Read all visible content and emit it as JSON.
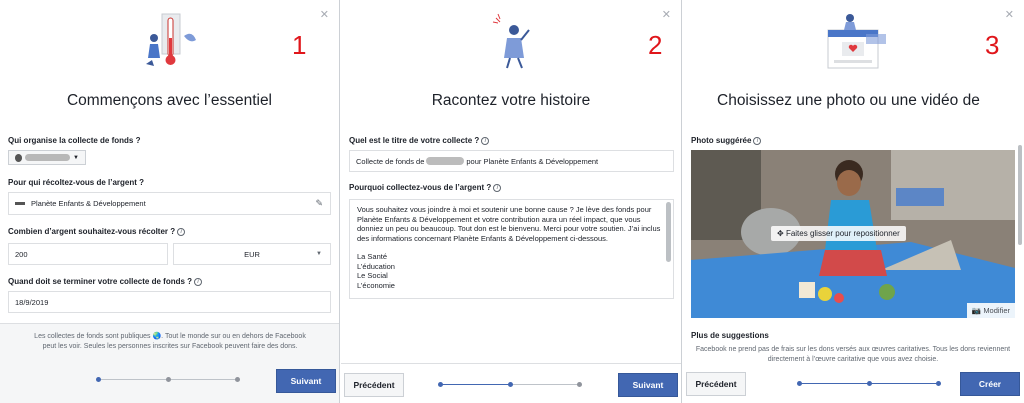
{
  "panel1": {
    "step": "1",
    "title": "Commençons avec l’essentiel",
    "organizer_label": "Qui organise la collecte de fonds ?",
    "beneficiary_label": "Pour qui récoltez-vous de l’argent ?",
    "beneficiary_value": "Planète Enfants & Développement",
    "amount_label": "Combien d’argent souhaitez-vous récolter ?",
    "amount_value": "200",
    "currency_value": "EUR",
    "end_label": "Quand doit se terminer votre collecte de fonds ?",
    "end_value": "18/9/2019",
    "note": "Les collectes de fonds sont publiques 🌏. Tout le monde sur ou en dehors de Facebook peut les voir. Seules les personnes inscrites sur Facebook peuvent faire des dons.",
    "next_label": "Suivant"
  },
  "panel2": {
    "step": "2",
    "title": "Racontez votre histoire",
    "collect_title_label": "Quel est le titre de votre collecte ?",
    "collect_title_prefix": "Collecte de fonds de",
    "collect_title_suffix": "pour Planète Enfants & Développement",
    "why_label": "Pourquoi collectez-vous de l’argent ?",
    "why_text": "Vous souhaitez vous joindre à moi et soutenir une bonne cause ? Je lève des fonds pour Planète Enfants & Développement et votre contribution aura un réel impact, que vous donniez un peu ou beaucoup. Tout don est le bienvenu. Merci pour votre soutien. J’ai inclus des informations concernant Planète Enfants & Développement ci-dessous.",
    "why_list": [
      "La Santé",
      "L’éducation",
      "Le Social",
      "L’économie"
    ],
    "prev_label": "Précédent",
    "next_label": "Suivant"
  },
  "panel3": {
    "step": "3",
    "title": "Choisissez une photo ou une vidéo de",
    "suggested_label": "Photo suggérée",
    "drag_hint": "Faites glisser pour repositionner",
    "edit_label": "Modifier",
    "more_label": "Plus de suggestions",
    "note": "Facebook ne prend pas de frais sur les dons versés aux œuvres caritatives. Tous les dons reviennent directement à l’œuvre caritative que vous avez choisie.",
    "prev_label": "Précédent",
    "create_label": "Créer"
  },
  "icons": {
    "close": "close-icon",
    "info": "info-icon",
    "pencil": "pencil-icon",
    "dropdown": "chevron-down-icon",
    "move": "move-icon",
    "camera": "camera-icon"
  },
  "colors": {
    "primary": "#4267b2",
    "step_number": "#e0161b",
    "border": "#dddfe2"
  }
}
